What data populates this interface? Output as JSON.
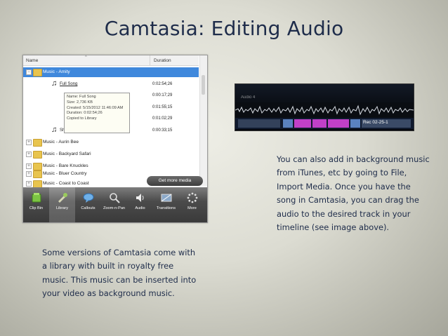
{
  "slide": {
    "title": "Camtasia: Editing Audio",
    "right_text": "You can also add in background music from iTunes, etc by going to File, Import Media.  Once you have the song in Camtasia, you can drag the audio to the desired track in your timeline (see image above).",
    "left_text": "Some versions of Camtasia come with a library with built in royalty free music.  This music can be inserted into your video as background music."
  },
  "library": {
    "columns": [
      "Name",
      "Duration"
    ],
    "selected_folder": "Music - Amity",
    "songs": [
      {
        "name": "Full Song",
        "duration": "0:02:54;26"
      },
      {
        "name": "",
        "duration": "0:00:17;29"
      },
      {
        "name": "",
        "duration": "0:01:55;15"
      },
      {
        "name": "",
        "duration": "0:01:02;29"
      },
      {
        "name": "Short",
        "duration": "0:00:33;15"
      }
    ],
    "tooltip": [
      "Name: Full Song",
      "Size: 2,736 KB",
      "Created: 5/15/2012 11:46:09 AM",
      "Duration: 0:02:54;26",
      "Copied to Library"
    ],
    "folders": [
      "Music - Aurin Bee",
      "Music - Backyard Safari",
      "Music - Bare Knuckles",
      "Music - Bluer Country",
      "Music - Coast to Coast"
    ],
    "get_more_label": "Get more media",
    "toolbar": [
      {
        "label": "Clip Bin",
        "icon": "clip-bin-icon"
      },
      {
        "label": "Library",
        "icon": "library-icon"
      },
      {
        "label": "Callouts",
        "icon": "callouts-icon"
      },
      {
        "label": "Zoom-n-Pan",
        "icon": "zoom-icon"
      },
      {
        "label": "Audio",
        "icon": "audio-icon"
      },
      {
        "label": "Transitions",
        "icon": "transitions-icon"
      },
      {
        "label": "More",
        "icon": "more-icon"
      }
    ]
  },
  "timeline": {
    "track_label": "Audio 4",
    "clip_label": "Rec 02-25-1"
  },
  "colors": {
    "title": "#1e2c4a",
    "selection": "#3f88dc",
    "clip_magenta": "#c040c8"
  }
}
